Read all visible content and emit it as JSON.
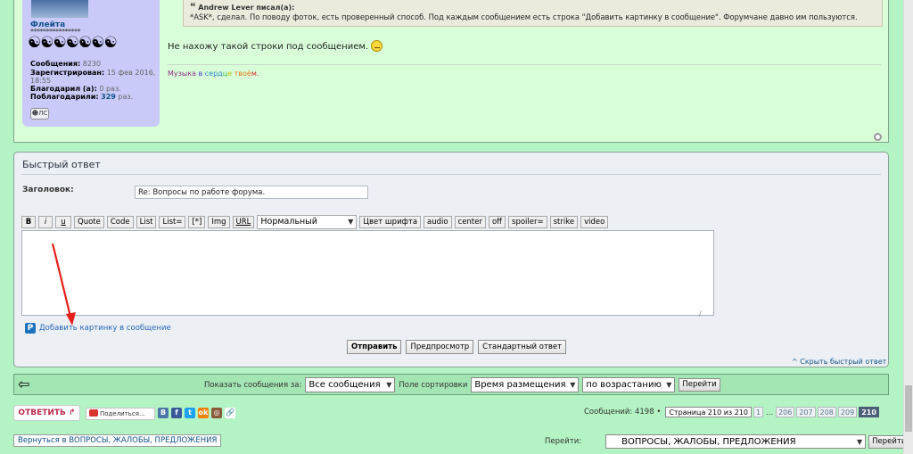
{
  "post": {
    "author": {
      "name": "Флейта",
      "rank": "****************",
      "rank_icons": "☯☯☯☯☯☯☯",
      "stats": [
        {
          "label": "Сообщения:",
          "value": "8230",
          "cls": "val"
        },
        {
          "label": "Зарегистрирован:",
          "value": "15 фев 2016,",
          "cls": "val"
        },
        {
          "label": "",
          "value": "18:55",
          "cls": "val"
        },
        {
          "label": "Благодарил (а):",
          "value": "0 раз.",
          "cls": "val"
        },
        {
          "label": "Поблагодарили:",
          "value": "329",
          "suffix": "раз.",
          "cls": "link"
        }
      ],
      "pm_label": "ЛС"
    },
    "quote_author": "Andrew Lever писал(а):",
    "quote_text": "*ASK*, сделал. По поводу фоток, есть проверенный способ. Под каждым сообщением есть строка \"Добавить картинку в сообщение\". Форумчане давно им пользуются.",
    "text": "Не нахожу такой строки под сообщением.",
    "signature": [
      {
        "t": "Музыка",
        "c": "#8e2c8a"
      },
      {
        "t": " ",
        "c": "#000"
      },
      {
        "t": "в",
        "c": "#4b33c7"
      },
      {
        "t": " ",
        "c": "#000"
      },
      {
        "t": "серд",
        "c": "#2a86c5"
      },
      {
        "t": "ц",
        "c": "#3fb64a"
      },
      {
        "t": "е",
        "c": "#c4b800"
      },
      {
        "t": " ",
        "c": "#000"
      },
      {
        "t": "твоё",
        "c": "#e2741c"
      },
      {
        "t": "м.",
        "c": "#d3262b"
      }
    ]
  },
  "quick_reply": {
    "title": "Быстрый ответ",
    "subject_label": "Заголовок:",
    "subject_value": "Re: Вопросы по работе форума.",
    "toolbar": [
      "B",
      "i",
      "u",
      "Quote",
      "Code",
      "List",
      "List=",
      "[*]",
      "Img",
      "URL"
    ],
    "font_size_value": "Нормальный",
    "toolbar2": [
      "Цвет шрифта",
      "audio",
      "center",
      "off",
      "spoiler=",
      "strike",
      "video"
    ],
    "add_image_label": "Добавить картинку в сообщение",
    "submit_label": "Отправить",
    "preview_label": "Предпросмотр",
    "standard_label": "Стандартный ответ",
    "collapse_label": "^ Скрыть быстрый ответ"
  },
  "sort_bar": {
    "show_label": "Показать сообщения за:",
    "show_value": "Все сообщения",
    "sort_label": "Поле сортировки",
    "sort_value": "Время размещения",
    "order_value": "по возрастанию",
    "go_label": "Перейти"
  },
  "bottom": {
    "reply_label": "ОТВЕТИТЬ",
    "share_label": "Поделиться...",
    "social": [
      {
        "name": "vk-icon",
        "char": "В",
        "color": "#4a76a8"
      },
      {
        "name": "facebook-icon",
        "char": "f",
        "color": "#3b5998"
      },
      {
        "name": "twitter-icon",
        "char": "t",
        "color": "#1da1f2"
      },
      {
        "name": "odnoklassniki-icon",
        "char": "ok",
        "color": "#ee8208"
      },
      {
        "name": "instagram-icon",
        "char": "◎",
        "color": "#8a5a3c"
      },
      {
        "name": "link-icon",
        "char": "🔗",
        "color": "#ffffff"
      }
    ],
    "post_count": "Сообщений: 4198 •",
    "page_select": "Страница 210 из 210",
    "pages": [
      "1",
      "…",
      "206",
      "207",
      "208",
      "209",
      "210"
    ],
    "return_label": "Вернуться в ВОПРОСЫ, ЖАЛОБЫ, ПРЕДЛОЖЕНИЯ",
    "jump_label": "Перейти:",
    "jump_value": "ВОПРОСЫ, ЖАЛОБЫ, ПРЕДЛОЖЕНИЯ",
    "jump_go": "Перейти"
  },
  "colors": {
    "page_bg": "#b4f3c3",
    "post_bg": "#d9ffd9",
    "profile_bg": "#c9caf9",
    "annotation_arrow": "#e8201a",
    "reply_red": "#bc2a4d"
  }
}
